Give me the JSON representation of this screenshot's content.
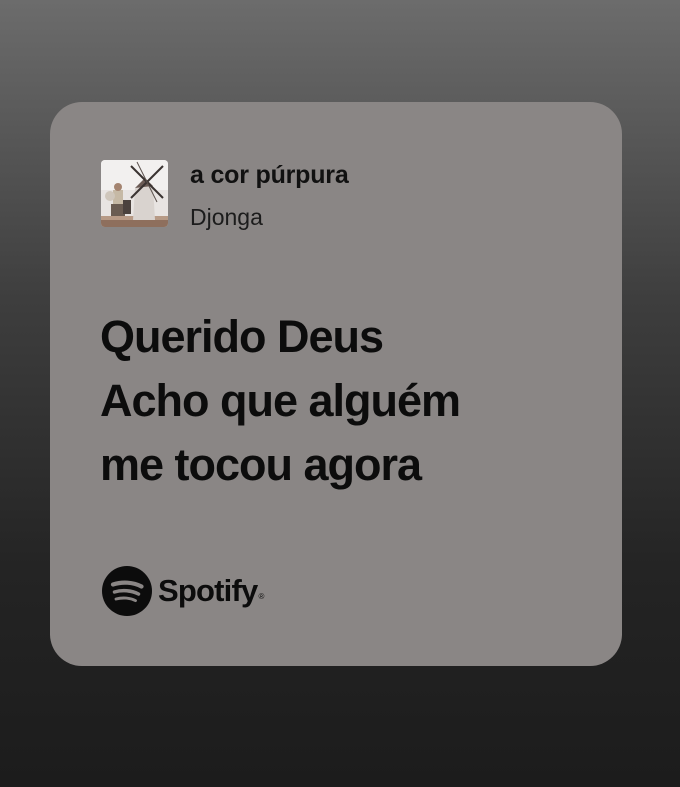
{
  "track": {
    "title": "a cor púrpura",
    "artist": "Djonga"
  },
  "lyrics": {
    "lines": [
      "Querido Deus",
      "Acho que alguém",
      "me tocou agora"
    ]
  },
  "brand": {
    "name": "Spotify",
    "registered_mark": "®",
    "logo_icon": "spotify-logo-icon"
  },
  "colors": {
    "card_background": "#8a8685",
    "text": "#0c0c0c",
    "page_background_top": "#6c6c6c",
    "page_background_bottom": "#1c1c1c"
  }
}
